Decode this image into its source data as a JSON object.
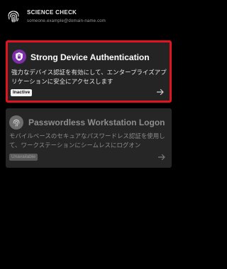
{
  "header": {
    "account_name": "SCIENCE CHECK",
    "account_sub": "someone.example@domain-name.com"
  },
  "cards": [
    {
      "title": "Strong Device Authentication",
      "description": "強力なデバイス認証を有効にして、エンタープライズアプリケーションに安全にアクセスします",
      "status": "Inactive",
      "icon": "shield-lock-icon",
      "accent": "#7a2ea8",
      "highlight": "#e0141e"
    },
    {
      "title": "Passwordless Workstation Logon",
      "description": "モバイルベースのセキュアなパスワードレス認証を使用して、ワークステーションにシームレスにログオン",
      "status": "Unavailable",
      "icon": "fingerprint-icon"
    }
  ]
}
